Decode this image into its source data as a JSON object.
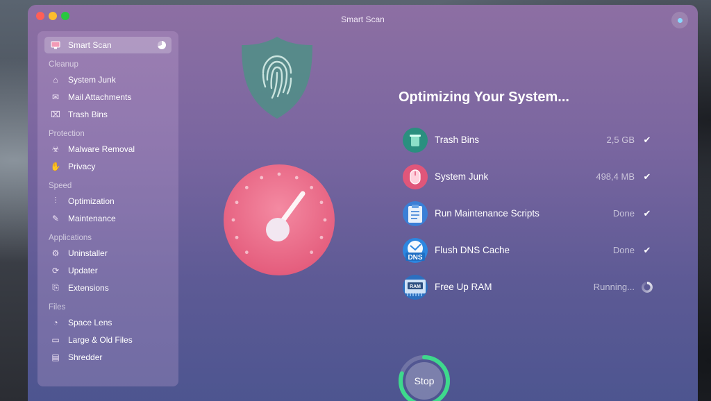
{
  "window": {
    "title": "Smart Scan"
  },
  "sidebar": {
    "active": {
      "label": "Smart Scan",
      "icon": "monitor-icon"
    },
    "sections": [
      {
        "title": "Cleanup",
        "items": [
          {
            "label": "System Junk",
            "icon": "system-junk-icon"
          },
          {
            "label": "Mail Attachments",
            "icon": "mail-icon"
          },
          {
            "label": "Trash Bins",
            "icon": "trash-icon"
          }
        ]
      },
      {
        "title": "Protection",
        "items": [
          {
            "label": "Malware Removal",
            "icon": "biohazard-icon"
          },
          {
            "label": "Privacy",
            "icon": "hand-icon"
          }
        ]
      },
      {
        "title": "Speed",
        "items": [
          {
            "label": "Optimization",
            "icon": "sliders-icon"
          },
          {
            "label": "Maintenance",
            "icon": "wrench-icon"
          }
        ]
      },
      {
        "title": "Applications",
        "items": [
          {
            "label": "Uninstaller",
            "icon": "uninstaller-icon"
          },
          {
            "label": "Updater",
            "icon": "updater-icon"
          },
          {
            "label": "Extensions",
            "icon": "extensions-icon"
          }
        ]
      },
      {
        "title": "Files",
        "items": [
          {
            "label": "Space Lens",
            "icon": "space-lens-icon"
          },
          {
            "label": "Large & Old Files",
            "icon": "folder-icon"
          },
          {
            "label": "Shredder",
            "icon": "shredder-icon"
          }
        ]
      }
    ]
  },
  "main": {
    "heading": "Optimizing Your System...",
    "tasks": [
      {
        "name": "Trash Bins",
        "status": "2,5 GB",
        "state": "done",
        "icon": "trash-bin-icon",
        "color": "#2a8f7f"
      },
      {
        "name": "System Junk",
        "status": "498,4 MB",
        "state": "done",
        "icon": "system-junk-icon",
        "color": "#e0567a"
      },
      {
        "name": "Run Maintenance Scripts",
        "status": "Done",
        "state": "done",
        "icon": "clipboard-icon",
        "color": "#3a7fd6"
      },
      {
        "name": "Flush DNS Cache",
        "status": "Done",
        "state": "done",
        "icon": "dns-icon",
        "color": "#2c86e0"
      },
      {
        "name": "Free Up RAM",
        "status": "Running...",
        "state": "running",
        "icon": "ram-icon",
        "color": "#2c6fbf"
      }
    ],
    "check_glyph": "✔",
    "dns_label": "DNS",
    "ram_label": "RAM"
  },
  "stop_button": {
    "label": "Stop",
    "progress_percent": 80,
    "color": "#3ed98c"
  }
}
